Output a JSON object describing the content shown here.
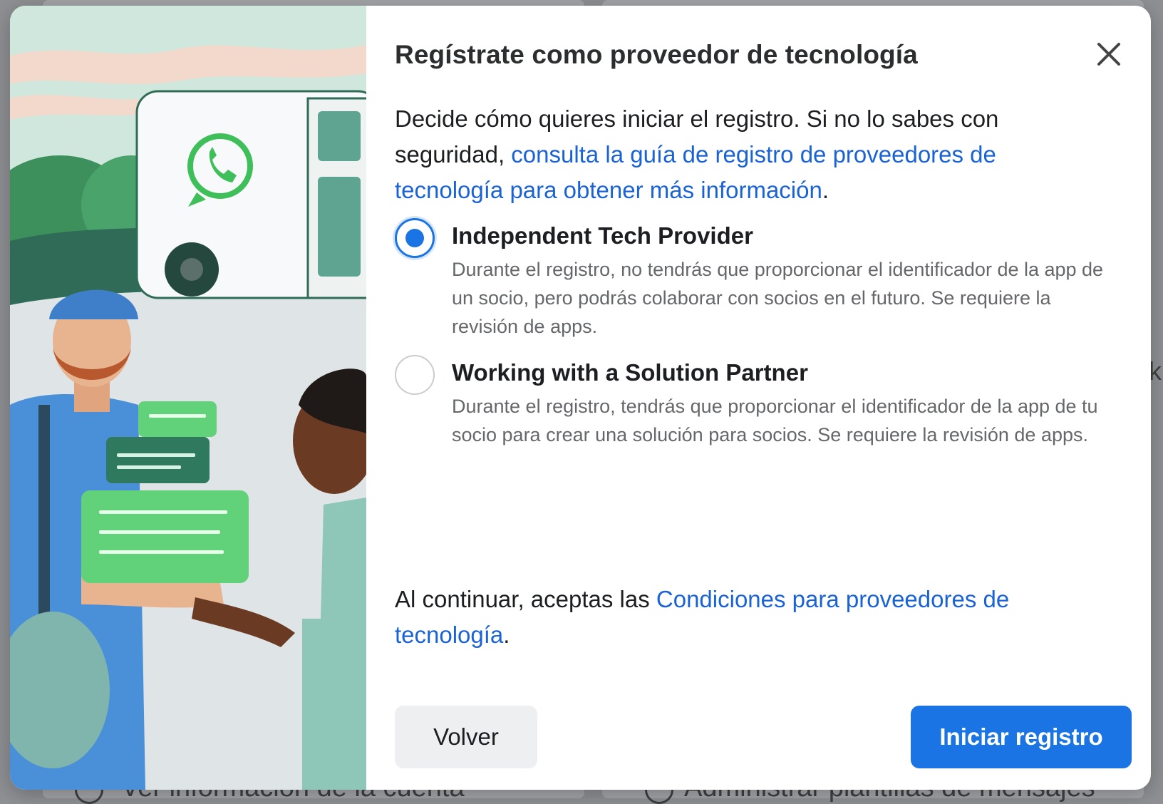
{
  "background": {
    "left_text": "Ver información de la cuenta",
    "right_text": "Administrar plantillas de mensajes",
    "edge_letter": "k"
  },
  "dialog": {
    "title": "Regístrate como proveedor de tecnología",
    "close_icon": "close-icon",
    "intro": {
      "text_before": "Decide cómo quieres iniciar el registro. Si no lo sabes con seguridad, ",
      "link_text": "consulta la guía de registro de proveedores de tecnología para obtener más información",
      "text_after": "."
    },
    "options": [
      {
        "title": "Independent Tech Provider",
        "description": "Durante el registro, no tendrás que proporcionar el identificador de la app de un socio, pero podrás colaborar con socios en el futuro. Se requiere la revisión de apps.",
        "selected": true
      },
      {
        "title": "Working with a Solution Partner",
        "description": "Durante el registro, tendrás que proporcionar el identificador de la app de tu socio para crear una solución para socios. Se requiere la revisión de apps.",
        "selected": false
      }
    ],
    "terms": {
      "text_before": "Al continuar, aceptas las ",
      "link_text": "Condiciones para proveedores de tecnología",
      "text_after": "."
    },
    "buttons": {
      "back": "Volver",
      "primary": "Iniciar registro"
    }
  },
  "colors": {
    "primary": "#1b74e4",
    "link": "#1a63d6",
    "whatsapp_green": "#3fbf5a"
  }
}
